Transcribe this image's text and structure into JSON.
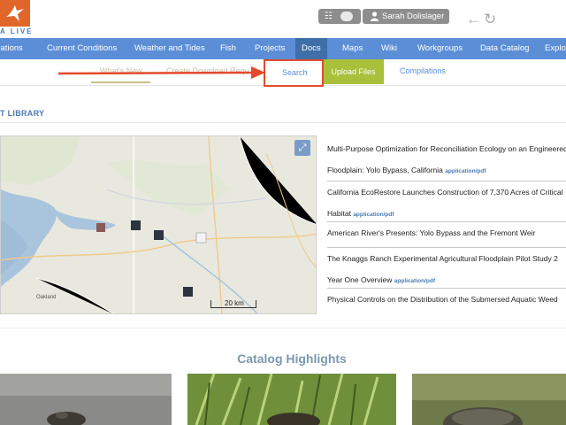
{
  "header": {
    "logo_text": "A LIVE",
    "cart_icon": "basket-icon",
    "user_name": "Sarah Dolislager",
    "back_icon": "arrow-left-icon",
    "refresh_icon": "refresh-icon"
  },
  "main_nav": {
    "items": [
      {
        "label": "erations"
      },
      {
        "label": "Current Conditions"
      },
      {
        "label": "Weather and Tides"
      },
      {
        "label": "Fish"
      },
      {
        "label": "Projects"
      },
      {
        "label": "Docs",
        "active": true
      },
      {
        "label": "Maps"
      },
      {
        "label": "Wiki"
      },
      {
        "label": "Workgroups"
      },
      {
        "label": "Data Catalog"
      },
      {
        "label": "Explor"
      }
    ]
  },
  "sub_nav": {
    "whats_new": "What's New",
    "create_download": "Create Download Requ",
    "search": "Search",
    "upload": "Upload Files",
    "compilations": "Compilations"
  },
  "library": {
    "title": "T LIBRARY",
    "map": {
      "scale_label": "20 km",
      "place_label": "Oakland",
      "expand_icon": "expand-icon"
    },
    "documents": [
      {
        "line1": "Multi-Purpose Optimization for Reconciliation Ecology on an Engineered",
        "line2": "Floodplain: Yolo Bypass, California",
        "type": "application/pdf"
      },
      {
        "line1": "California EcoRestore Launches Construction of 7,370 Acres of Critical",
        "line2": "Habitat",
        "type": "application/pdf"
      },
      {
        "line1": "American River's Presents: Yolo Bypass and the Fremont Weir",
        "line2": "",
        "type": ""
      },
      {
        "line1": "The Knaggs Ranch Experimental Agricultural Floodplain Pilot Study 2",
        "line2": "Year One Overview",
        "type": "application/pdf"
      },
      {
        "line1": "Physical Controls on the Distribution of the Submersed Aquatic Weed",
        "line2": "",
        "type": ""
      }
    ]
  },
  "catalog": {
    "title": "Catalog Highlights"
  },
  "colors": {
    "nav_blue": "#5b8ed6",
    "nav_active": "#3f6fa8",
    "upload_green": "#a8c03a",
    "annotation_red": "#e34a2c",
    "logo_orange": "#e0662a"
  }
}
